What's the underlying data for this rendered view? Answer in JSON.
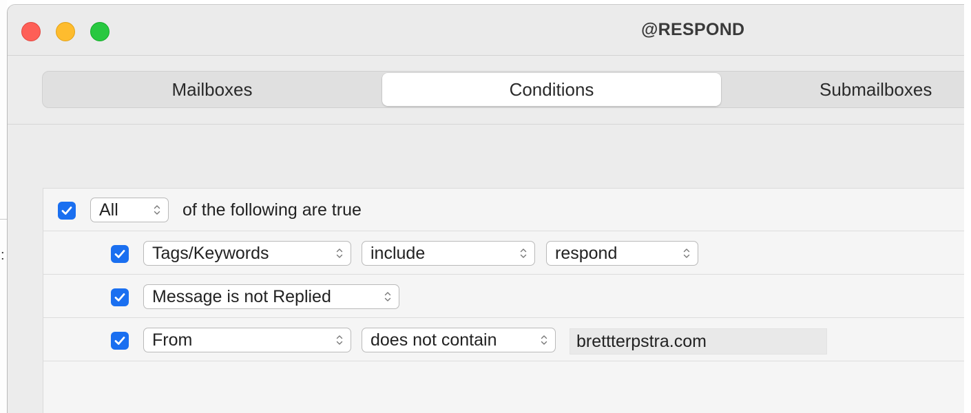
{
  "window": {
    "title": "@RESPOND"
  },
  "tabs": [
    {
      "label": "Mailboxes",
      "selected": false
    },
    {
      "label": "Conditions",
      "selected": true
    },
    {
      "label": "Submailboxes",
      "selected": false
    }
  ],
  "conditions": {
    "header": {
      "checked": true,
      "match": "All",
      "text": "of the following are true"
    },
    "rules": [
      {
        "checked": true,
        "field": "Tags/Keywords",
        "operator": "include",
        "value": "respond"
      },
      {
        "checked": true,
        "field": "Message is not Replied"
      },
      {
        "checked": true,
        "field": "From",
        "operator": "does not contain",
        "value": "brettterpstra.com"
      }
    ]
  },
  "colors": {
    "accent": "#1a6ff0",
    "close": "#fe5f57",
    "minimize": "#febc2e",
    "zoom": "#28c840"
  },
  "icons": [
    "checkmark-icon",
    "up-down-chevron-icon"
  ]
}
